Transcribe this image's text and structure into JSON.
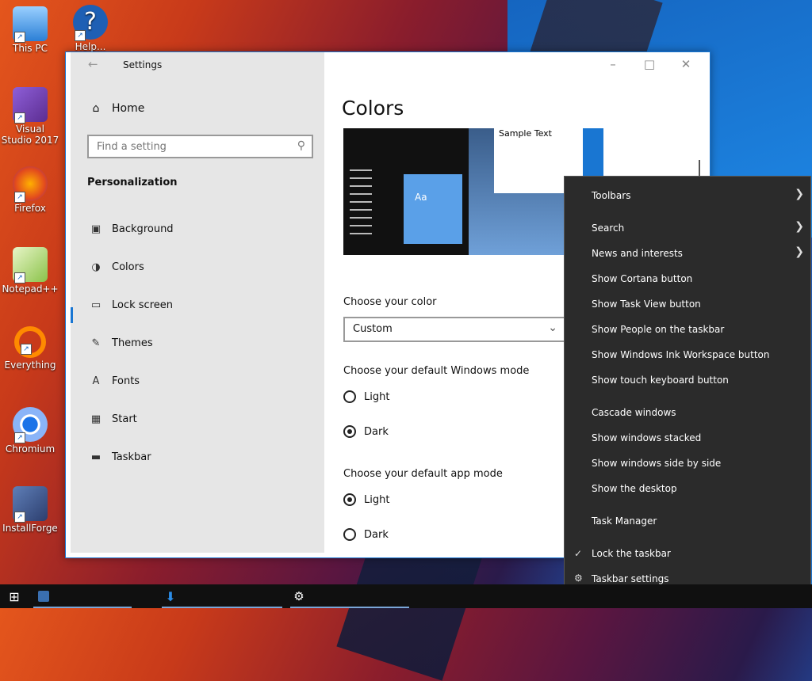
{
  "desktop": {
    "icons": [
      {
        "label": "This PC",
        "icon": "computer-icon"
      },
      {
        "label": "Help...",
        "icon": "help-icon"
      },
      {
        "label": "Visual Studio 2017",
        "icon": "visual-studio-icon"
      },
      {
        "label": "Firefox",
        "icon": "firefox-icon"
      },
      {
        "label": "Notepad++",
        "icon": "notepad-plus-plus-icon"
      },
      {
        "label": "Everything",
        "icon": "everything-search-icon"
      },
      {
        "label": "Chromium",
        "icon": "chromium-icon"
      },
      {
        "label": "InstallForge",
        "icon": "installforge-icon"
      }
    ]
  },
  "settings": {
    "window_title": "Settings",
    "home_label": "Home",
    "search_placeholder": "Find a setting",
    "section_title": "Personalization",
    "nav": [
      {
        "label": "Background",
        "icon": "image-icon"
      },
      {
        "label": "Colors",
        "icon": "palette-icon",
        "active": true
      },
      {
        "label": "Lock screen",
        "icon": "lock-screen-icon"
      },
      {
        "label": "Themes",
        "icon": "brush-icon"
      },
      {
        "label": "Fonts",
        "icon": "font-icon"
      },
      {
        "label": "Start",
        "icon": "start-icon"
      },
      {
        "label": "Taskbar",
        "icon": "taskbar-icon"
      }
    ],
    "page_title": "Colors",
    "preview_sample_text": "Sample Text",
    "preview_tile_text": "Aa",
    "choose_color_label": "Choose your color",
    "choose_color_value": "Custom",
    "windows_mode_label": "Choose your default Windows mode",
    "windows_mode_options": [
      {
        "label": "Light",
        "selected": false
      },
      {
        "label": "Dark",
        "selected": true
      }
    ],
    "app_mode_label": "Choose your default app mode",
    "app_mode_options": [
      {
        "label": "Light",
        "selected": true
      },
      {
        "label": "Dark",
        "selected": false
      }
    ],
    "accent_color": "#1976d2"
  },
  "context_menu": {
    "items": [
      {
        "label": "Toolbars",
        "submenu": true
      },
      {
        "label": "Search",
        "submenu": true
      },
      {
        "label": "News and interests",
        "submenu": true
      },
      {
        "label": "Show Cortana button"
      },
      {
        "label": "Show Task View button"
      },
      {
        "label": "Show People on the taskbar"
      },
      {
        "label": "Show Windows Ink Workspace button"
      },
      {
        "label": "Show touch keyboard button"
      },
      {
        "label": "Cascade windows"
      },
      {
        "label": "Show windows stacked"
      },
      {
        "label": "Show windows side by side"
      },
      {
        "label": "Show the desktop"
      },
      {
        "label": "Task Manager"
      },
      {
        "label": "Lock the taskbar",
        "checked": true
      },
      {
        "label": "Taskbar settings",
        "icon": "gear-icon"
      }
    ]
  },
  "taskbar": {
    "start_icon": "windows-start-icon",
    "items": [
      "app-icon",
      "download-icon",
      "settings-gear-icon"
    ]
  }
}
